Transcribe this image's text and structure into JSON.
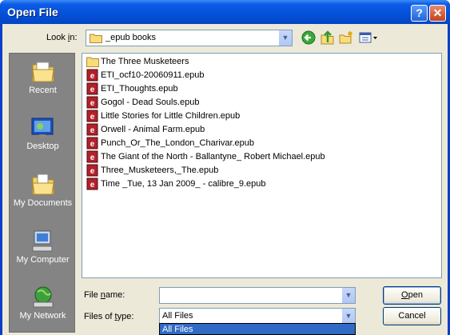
{
  "window": {
    "title": "Open File",
    "help_glyph": "?",
    "close_glyph": "✕"
  },
  "toolbar": {
    "lookin_label": "Look in:",
    "lookin_value": "_epub books",
    "icons": [
      "back-icon",
      "up-folder-icon",
      "new-folder-icon",
      "views-menu-icon"
    ]
  },
  "places": [
    {
      "label": "Recent",
      "icon": "recent-documents-icon"
    },
    {
      "label": "Desktop",
      "icon": "desktop-icon"
    },
    {
      "label": "My Documents",
      "icon": "my-documents-icon"
    },
    {
      "label": "My Computer",
      "icon": "my-computer-icon"
    },
    {
      "label": "My Network",
      "icon": "my-network-icon"
    }
  ],
  "files": [
    {
      "name": "The Three Musketeers",
      "type": "folder"
    },
    {
      "name": "ETI_ocf10-20060911.epub",
      "type": "epub"
    },
    {
      "name": "ETI_Thoughts.epub",
      "type": "epub"
    },
    {
      "name": "Gogol - Dead Souls.epub",
      "type": "epub"
    },
    {
      "name": "Little Stories for Little Children.epub",
      "type": "epub"
    },
    {
      "name": "Orwell - Animal Farm.epub",
      "type": "epub"
    },
    {
      "name": "Punch_Or_The_London_Charivar.epub",
      "type": "epub"
    },
    {
      "name": "The Giant of the North - Ballantyne_ Robert Michael.epub",
      "type": "epub"
    },
    {
      "name": "Three_Musketeers,_The.epub",
      "type": "epub"
    },
    {
      "name": "Time _Tue, 13 Jan 2009_ - calibre_9.epub",
      "type": "epub"
    }
  ],
  "form": {
    "filename_label": "File name:",
    "filename_value": "",
    "filetype_label": "Files of type:",
    "filetype_value": "All Files",
    "dropdown_option": "All Files"
  },
  "buttons": {
    "open": "Open",
    "cancel": "Cancel"
  },
  "colors": {
    "title_bar": "#0450d8",
    "places_bg": "#848484",
    "selection": "#316ac5",
    "epub_icon": "#b3202a"
  }
}
